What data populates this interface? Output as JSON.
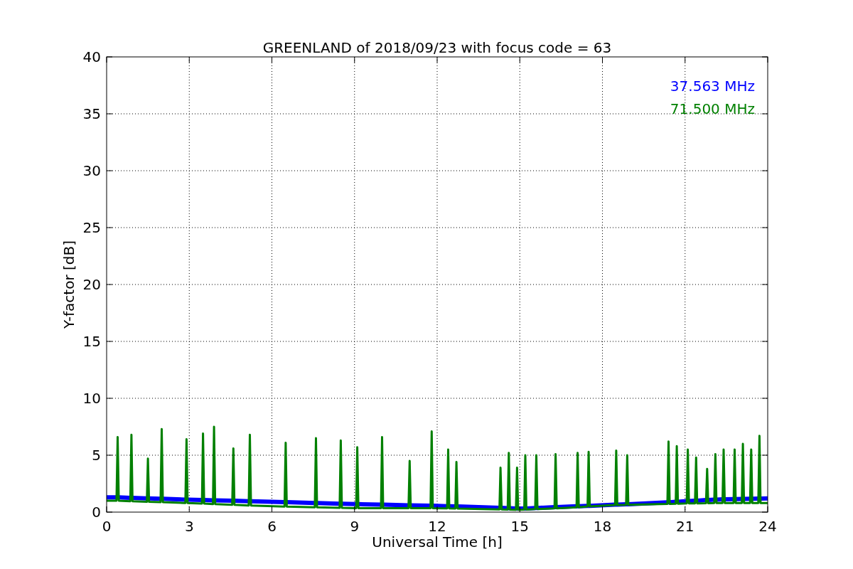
{
  "chart_data": {
    "type": "line",
    "grid": true,
    "title": "GREENLAND of 2018/09/23 with focus code = 63",
    "xlabel": "Universal Time [h]",
    "ylabel": "Y-factor [dB]",
    "xlim": [
      0,
      24
    ],
    "ylim": [
      0,
      40
    ],
    "xticks": [
      0,
      3,
      6,
      9,
      12,
      15,
      18,
      21,
      24
    ],
    "yticks": [
      0,
      5,
      10,
      15,
      20,
      25,
      30,
      35,
      40
    ],
    "x": [
      0,
      0.36,
      0.4,
      0.44,
      0.86,
      0.9,
      0.94,
      1.46,
      1.5,
      1.54,
      1.96,
      2.0,
      2.04,
      2.86,
      2.9,
      2.94,
      3.46,
      3.5,
      3.54,
      3.86,
      3.9,
      3.94,
      4.56,
      4.6,
      4.64,
      5.16,
      5.2,
      5.24,
      6.46,
      6.5,
      6.54,
      7.56,
      7.6,
      7.64,
      8.46,
      8.5,
      8.54,
      9.06,
      9.1,
      9.14,
      9.96,
      10.0,
      10.04,
      10.96,
      11.0,
      11.04,
      11.76,
      11.8,
      11.84,
      12.36,
      12.4,
      12.44,
      12.66,
      12.7,
      12.74,
      14.26,
      14.3,
      14.34,
      14.56,
      14.6,
      14.64,
      14.86,
      14.9,
      14.94,
      15.16,
      15.2,
      15.24,
      15.56,
      15.6,
      15.64,
      16.26,
      16.3,
      16.34,
      17.06,
      17.1,
      17.14,
      17.46,
      17.5,
      17.54,
      18.46,
      18.5,
      18.54,
      18.86,
      18.9,
      18.94,
      20.36,
      20.4,
      20.44,
      20.66,
      20.7,
      20.74,
      21.06,
      21.1,
      21.14,
      21.36,
      21.4,
      21.44,
      21.76,
      21.8,
      21.84,
      22.06,
      22.1,
      22.14,
      22.36,
      22.4,
      22.44,
      22.76,
      22.8,
      22.84,
      23.06,
      23.1,
      23.14,
      23.36,
      23.4,
      23.44,
      23.66,
      23.7,
      23.74,
      24
    ],
    "series": [
      {
        "name": "37.563 MHz",
        "color": "#0000ff",
        "values": [
          1.3,
          1.3,
          1.3,
          1.3,
          1.25,
          1.25,
          1.25,
          1.2,
          1.2,
          1.2,
          1.17,
          1.17,
          1.17,
          1.1,
          1.1,
          1.1,
          1.07,
          1.07,
          1.07,
          1.04,
          1.04,
          1.04,
          1.0,
          1.0,
          1.0,
          0.95,
          0.95,
          0.95,
          0.87,
          0.87,
          0.87,
          0.8,
          0.8,
          0.8,
          0.73,
          0.73,
          0.73,
          0.7,
          0.7,
          0.7,
          0.65,
          0.65,
          0.65,
          0.6,
          0.6,
          0.6,
          0.56,
          0.56,
          0.56,
          0.52,
          0.52,
          0.52,
          0.5,
          0.5,
          0.5,
          0.37,
          0.37,
          0.37,
          0.34,
          0.34,
          0.34,
          0.31,
          0.31,
          0.31,
          0.32,
          0.32,
          0.32,
          0.36,
          0.36,
          0.36,
          0.43,
          0.43,
          0.43,
          0.51,
          0.51,
          0.51,
          0.55,
          0.55,
          0.55,
          0.65,
          0.65,
          0.65,
          0.69,
          0.69,
          0.69,
          0.86,
          0.86,
          0.86,
          0.9,
          0.9,
          0.9,
          0.97,
          0.97,
          0.97,
          1.0,
          1.0,
          1.0,
          1.07,
          1.07,
          1.07,
          1.1,
          1.1,
          1.1,
          1.12,
          1.12,
          1.12,
          1.14,
          1.14,
          1.14,
          1.15,
          1.15,
          1.15,
          1.17,
          1.17,
          1.17,
          1.18,
          1.18,
          1.18,
          1.2
        ]
      },
      {
        "name": "71.500 MHz",
        "color": "#008000",
        "values": [
          1.0,
          1.0,
          6.6,
          1.0,
          0.95,
          6.8,
          0.95,
          0.9,
          4.7,
          0.9,
          0.87,
          7.3,
          0.87,
          0.8,
          6.4,
          0.8,
          0.75,
          6.9,
          0.75,
          0.7,
          7.5,
          0.7,
          0.64,
          5.6,
          0.64,
          0.58,
          6.8,
          0.58,
          0.48,
          6.1,
          0.48,
          0.42,
          6.5,
          0.42,
          0.37,
          6.3,
          0.37,
          0.35,
          5.7,
          0.35,
          0.35,
          6.6,
          0.35,
          0.35,
          4.5,
          0.35,
          0.35,
          7.1,
          0.35,
          0.33,
          5.5,
          0.33,
          0.32,
          4.4,
          0.32,
          0.24,
          3.9,
          0.24,
          0.22,
          5.2,
          0.22,
          0.2,
          3.9,
          0.2,
          0.22,
          5.0,
          0.22,
          0.26,
          5.0,
          0.26,
          0.33,
          5.1,
          0.33,
          0.42,
          5.2,
          0.42,
          0.5,
          5.3,
          0.5,
          0.62,
          5.4,
          0.62,
          0.64,
          5.0,
          0.64,
          0.72,
          6.2,
          0.72,
          0.73,
          5.8,
          0.73,
          0.76,
          5.5,
          0.76,
          0.77,
          4.8,
          0.77,
          0.79,
          3.8,
          0.79,
          0.8,
          5.1,
          0.8,
          0.8,
          5.5,
          0.8,
          0.8,
          5.5,
          0.8,
          0.8,
          6.0,
          0.8,
          0.8,
          5.5,
          0.8,
          0.8,
          6.7,
          0.8,
          0.8
        ]
      }
    ]
  }
}
